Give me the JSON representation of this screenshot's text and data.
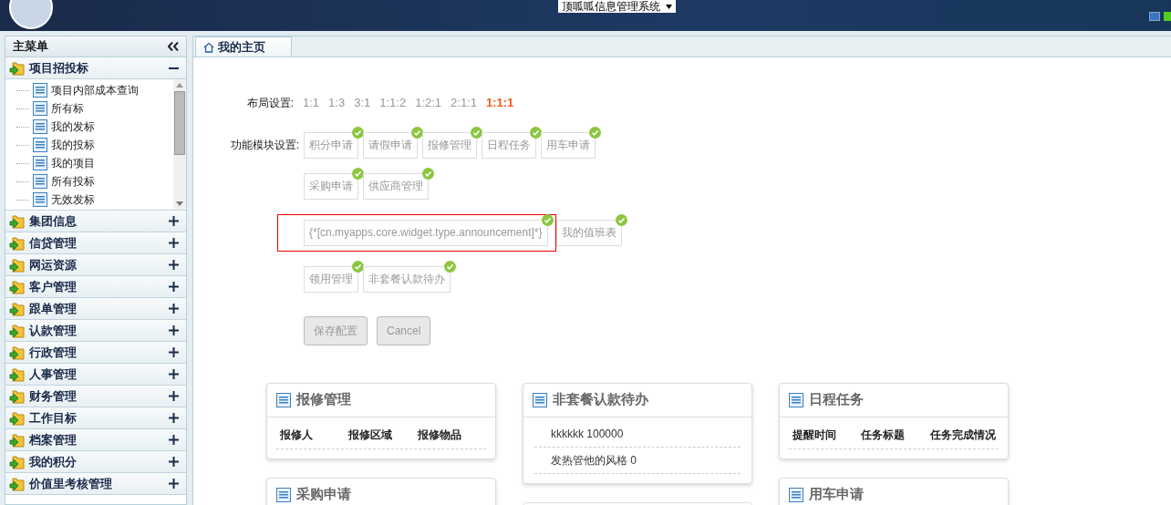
{
  "header": {
    "system_select": "顶呱呱信息管理系统"
  },
  "sidebar": {
    "title": "主菜单",
    "groups": [
      {
        "label": "项目招投标",
        "expanded": true,
        "children": [
          "项目内部成本查询",
          "所有标",
          "我的发标",
          "我的投标",
          "我的项目",
          "所有投标",
          "无效发标"
        ]
      },
      {
        "label": "集团信息",
        "expanded": false
      },
      {
        "label": "信贷管理",
        "expanded": false
      },
      {
        "label": "网运资源",
        "expanded": false
      },
      {
        "label": "客户管理",
        "expanded": false
      },
      {
        "label": "跟单管理",
        "expanded": false
      },
      {
        "label": "认款管理",
        "expanded": false
      },
      {
        "label": "行政管理",
        "expanded": false
      },
      {
        "label": "人事管理",
        "expanded": false
      },
      {
        "label": "财务管理",
        "expanded": false
      },
      {
        "label": "工作目标",
        "expanded": false
      },
      {
        "label": "档案管理",
        "expanded": false
      },
      {
        "label": "我的积分",
        "expanded": false
      },
      {
        "label": "价值里考核管理",
        "expanded": false
      }
    ]
  },
  "tabs": [
    {
      "label": "我的主页",
      "selected": true
    }
  ],
  "layout": {
    "label": "布局设置:",
    "options": [
      {
        "label": "1:1",
        "selected": false
      },
      {
        "label": "1:3",
        "selected": false
      },
      {
        "label": "3:1",
        "selected": false
      },
      {
        "label": "1:1:2",
        "selected": false
      },
      {
        "label": "1:2:1",
        "selected": false
      },
      {
        "label": "2:1:1",
        "selected": false
      },
      {
        "label": "1:1:1",
        "selected": true
      }
    ]
  },
  "modules": {
    "label": "功能模块设置:",
    "lines": [
      {
        "items": [
          {
            "label": "积分申请",
            "checked": true,
            "flagged": false
          },
          {
            "label": "请假申请",
            "checked": true,
            "flagged": false
          },
          {
            "label": "报修管理",
            "checked": true,
            "flagged": false
          },
          {
            "label": "日程任务",
            "checked": true,
            "flagged": false
          },
          {
            "label": "用车申请",
            "checked": true,
            "flagged": false
          }
        ]
      },
      {
        "items": [
          {
            "label": "采购申请",
            "checked": true,
            "flagged": false
          },
          {
            "label": "供应商管理",
            "checked": true,
            "flagged": false
          }
        ]
      },
      {
        "items": [
          {
            "label": "{*[cn.myapps.core.widget.type.announcement]*}",
            "checked": true,
            "flagged": true
          },
          {
            "label": "我的值班表",
            "checked": true,
            "flagged": false
          }
        ]
      },
      {
        "items": [
          {
            "label": "领用管理",
            "checked": true,
            "flagged": false
          },
          {
            "label": "非套餐认款待办",
            "checked": true,
            "flagged": false
          }
        ]
      }
    ]
  },
  "buttons": [
    {
      "label": "保存配置"
    },
    {
      "label": "Cancel"
    }
  ],
  "widget_columns": [
    [
      {
        "kind": "table",
        "title": "报修管理",
        "columns": [
          "报修人",
          "报修区域",
          "报修物品"
        ]
      },
      {
        "kind": "table",
        "title": "采购申请"
      }
    ],
    [
      {
        "kind": "list",
        "title": "非套餐认款待办",
        "items": [
          "kkkkkk 100000",
          "发热管他的风格 0"
        ]
      },
      {
        "kind": "blank"
      }
    ],
    [
      {
        "kind": "table",
        "title": "日程任务",
        "columns": [
          "提醒时间",
          "任务标题",
          "任务完成情况"
        ]
      },
      {
        "kind": "table",
        "title": "用车申请"
      }
    ]
  ]
}
